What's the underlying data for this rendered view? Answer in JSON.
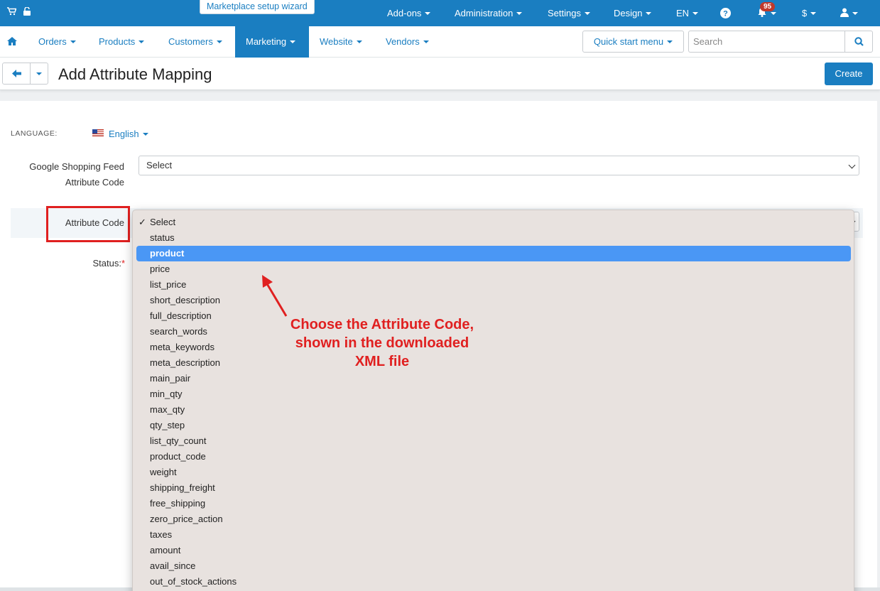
{
  "topbar": {
    "wizard_label": "Marketplace setup wizard",
    "menus": [
      "Add-ons",
      "Administration",
      "Settings",
      "Design",
      "EN"
    ],
    "notifications_count": "95",
    "currency": "$",
    "color": "#1a7ec1"
  },
  "mainnav": {
    "items": [
      {
        "label": "Orders"
      },
      {
        "label": "Products"
      },
      {
        "label": "Customers"
      },
      {
        "label": "Marketing",
        "active": true
      },
      {
        "label": "Website"
      },
      {
        "label": "Vendors"
      }
    ],
    "quick_start": "Quick start menu",
    "search_placeholder": "Search"
  },
  "header": {
    "title": "Add Attribute Mapping",
    "create_label": "Create"
  },
  "form": {
    "language_label": "LANGUAGE:",
    "language_value": "English",
    "feed_label_line1": "Google Shopping Feed",
    "feed_label_line2": "Attribute Code",
    "feed_value": "Select",
    "attribute_label": "Attribute Code",
    "status_label": "Status:",
    "required_mark": "*"
  },
  "dropdown": {
    "options": [
      "Select",
      "status",
      "product",
      "price",
      "list_price",
      "short_description",
      "full_description",
      "search_words",
      "meta_keywords",
      "meta_description",
      "main_pair",
      "min_qty",
      "max_qty",
      "qty_step",
      "list_qty_count",
      "product_code",
      "weight",
      "shipping_freight",
      "free_shipping",
      "zero_price_action",
      "taxes",
      "amount",
      "avail_since",
      "out_of_stock_actions"
    ],
    "checked": "Select",
    "highlighted": "product"
  },
  "annotation": {
    "line1": "Choose the Attribute Code,",
    "line2": "shown in the downloaded",
    "line3": "XML file",
    "color": "#e02020"
  }
}
